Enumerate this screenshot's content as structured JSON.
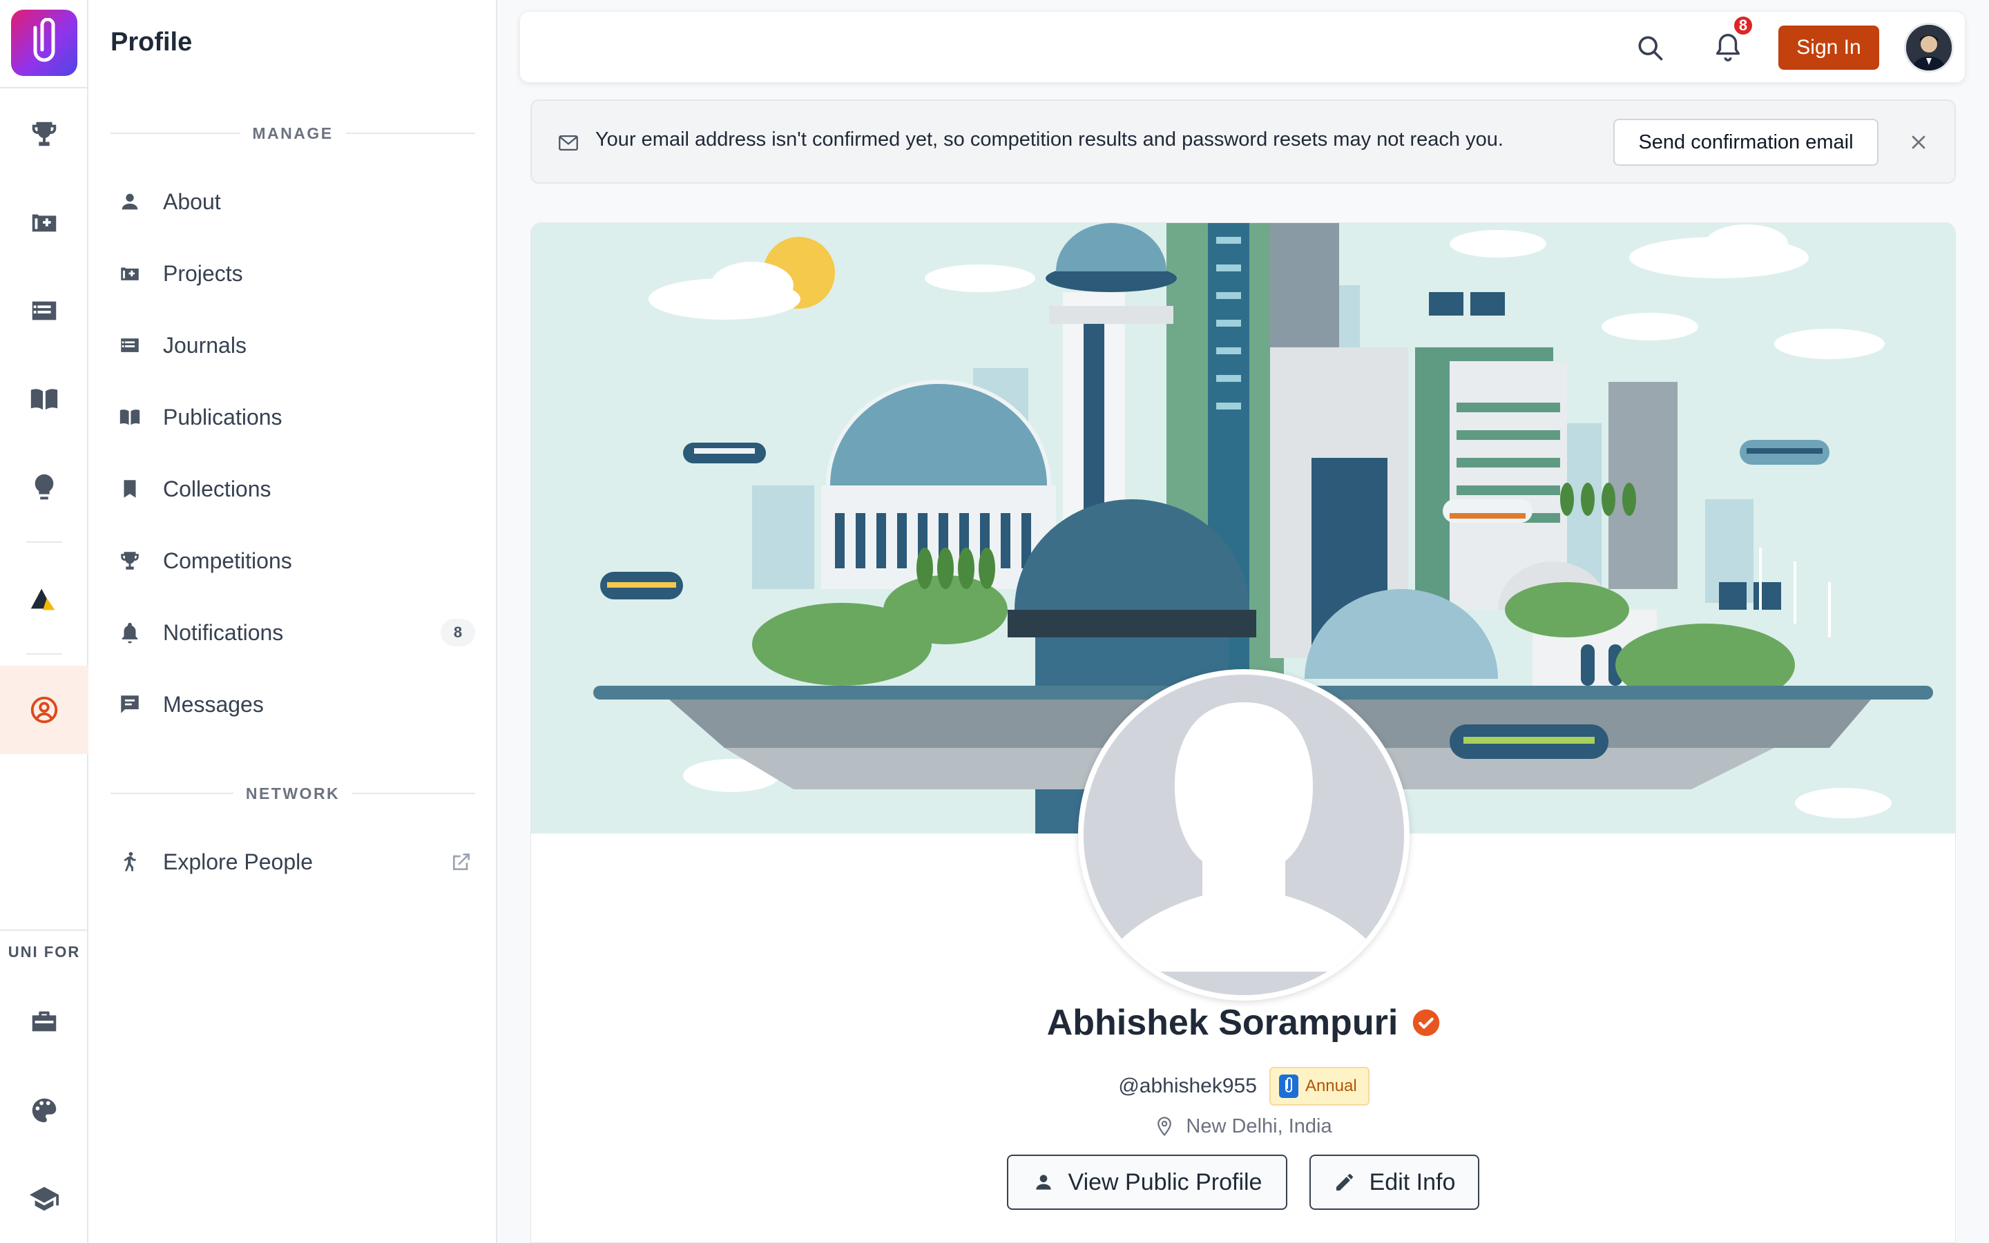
{
  "app": {
    "logo_name": "app-logo"
  },
  "rail": {
    "items": [
      {
        "name": "competitions",
        "icon": "trophy-icon"
      },
      {
        "name": "projects",
        "icon": "project-icon"
      },
      {
        "name": "journals",
        "icon": "journal-icon"
      },
      {
        "name": "publications",
        "icon": "book-icon"
      },
      {
        "name": "ideas",
        "icon": "bulb-icon"
      },
      {
        "name": "platform",
        "icon": "triangle-logo-icon"
      },
      {
        "name": "profile",
        "icon": "user-circle-icon",
        "active": true
      }
    ],
    "section_label": "UNI FOR",
    "bottom_items": [
      {
        "name": "business",
        "icon": "briefcase-icon"
      },
      {
        "name": "creators",
        "icon": "palette-icon"
      },
      {
        "name": "education",
        "icon": "graduation-cap-icon"
      }
    ]
  },
  "sidebar": {
    "title": "Profile",
    "manage_label": "MANAGE",
    "network_label": "NETWORK",
    "items": [
      {
        "label": "About",
        "icon": "person-icon"
      },
      {
        "label": "Projects",
        "icon": "project-icon"
      },
      {
        "label": "Journals",
        "icon": "journal-icon"
      },
      {
        "label": "Publications",
        "icon": "book-icon"
      },
      {
        "label": "Collections",
        "icon": "bookmark-icon"
      },
      {
        "label": "Competitions",
        "icon": "trophy-icon"
      },
      {
        "label": "Notifications",
        "icon": "bell-icon",
        "count": "8"
      },
      {
        "label": "Messages",
        "icon": "chat-icon"
      }
    ],
    "network_items": [
      {
        "label": "Explore People",
        "icon": "walking-person-icon"
      }
    ]
  },
  "topbar": {
    "notification_count": "8",
    "sign_in_label": "Sign In"
  },
  "alert": {
    "message": "Your email address isn't confirmed yet, so competition results and password resets may not reach you.",
    "action_label": "Send confirmation email"
  },
  "profile": {
    "name": "Abhishek Sorampuri",
    "handle": "@abhishek955",
    "plan": "Annual",
    "location": "New Delhi, India",
    "view_public_label": "View Public Profile",
    "edit_label": "Edit Info"
  },
  "colors": {
    "accent": "#c2410c",
    "active_bg": "#fdeee8",
    "badge": "#dc2626",
    "verified": "#e8551f",
    "plan_bg": "#fef3c7"
  }
}
